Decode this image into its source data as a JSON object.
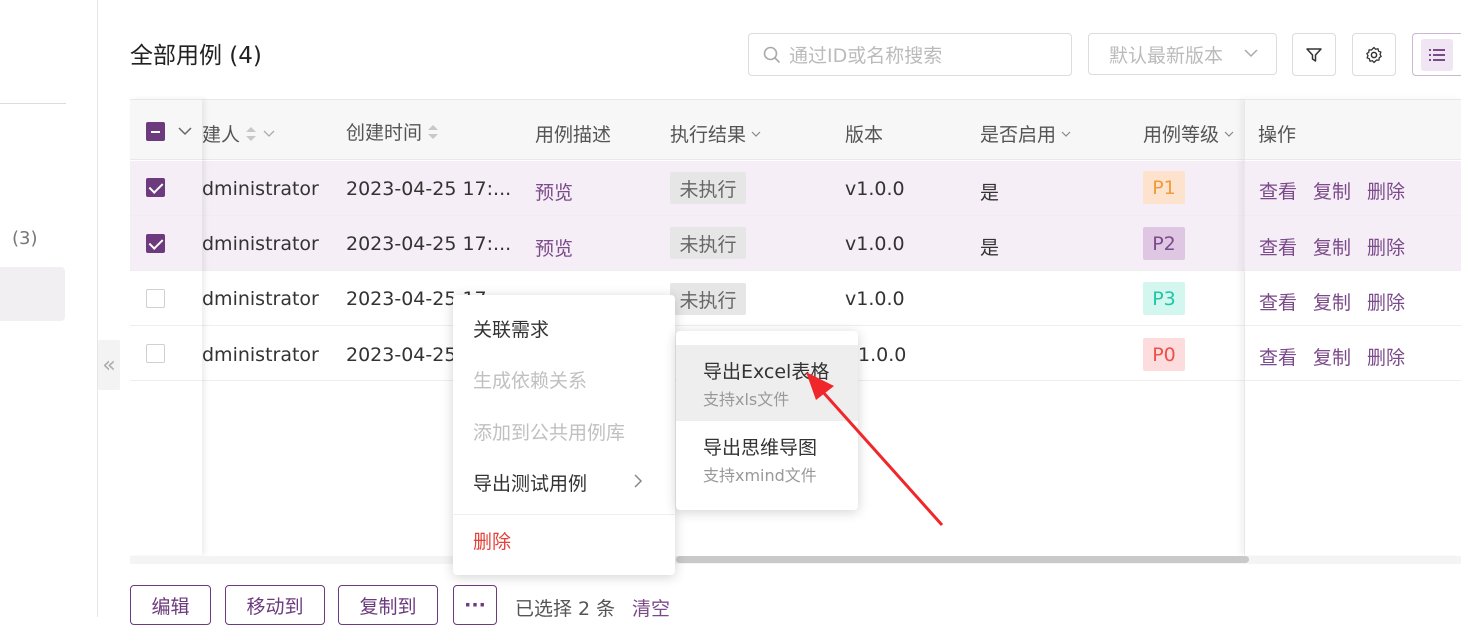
{
  "header": {
    "title": "全部用例 (4)",
    "search_placeholder": "通过ID或名称搜索",
    "version_placeholder": "默认最新版本"
  },
  "sidebar": {
    "count": "(3)"
  },
  "table": {
    "columns": {
      "creator": "建人",
      "created_time": "创建时间",
      "description": "用例描述",
      "result": "执行结果",
      "version": "版本",
      "enabled": "是否启用",
      "level": "用例等级",
      "actions": "操作"
    },
    "rows": [
      {
        "creator": "dministrator",
        "time": "2023-04-25 17:...",
        "desc": "预览",
        "result": "未执行",
        "version": "v1.0.0",
        "enabled": "是",
        "level": "P1"
      },
      {
        "creator": "dministrator",
        "time": "2023-04-25 17:...",
        "desc": "预览",
        "result": "未执行",
        "version": "v1.0.0",
        "enabled": "是",
        "level": "P2"
      },
      {
        "creator": "dministrator",
        "time": "2023-04-25 17",
        "desc": "",
        "result": "未执行",
        "version": "v1.0.0",
        "enabled": "",
        "level": "P3"
      },
      {
        "creator": "dministrator",
        "time": "2023-04-25",
        "desc": "",
        "result": "",
        "version": "1.0.0",
        "enabled": "",
        "level": "P0"
      }
    ],
    "row_actions": {
      "view": "查看",
      "copy": "复制",
      "delete": "删除"
    }
  },
  "bottom_bar": {
    "edit": "编辑",
    "move": "移动到",
    "copy": "复制到",
    "more": "···",
    "selected": "已选择 2 条",
    "clear": "清空"
  },
  "context_menu": {
    "items": [
      "关联需求",
      "生成依赖关系",
      "添加到公共用例库",
      "导出测试用例"
    ],
    "delete": "删除",
    "submenu": [
      {
        "title": "导出Excel表格",
        "desc": "支持xls文件"
      },
      {
        "title": "导出思维导图",
        "desc": "支持xmind文件"
      }
    ]
  },
  "colors": {
    "primary": "#6c3a7d",
    "selected_row": "#f5eef6",
    "danger": "#e5413a",
    "p1_bg": "#fde3cd",
    "p1_fg": "#f29a3a",
    "p2_bg": "#dfc7e4",
    "p2_fg": "#7b4a8a",
    "p3_bg": "#d3f6ee",
    "p3_fg": "#20c6a8",
    "p0_bg": "#fcdcdc",
    "p0_fg": "#f0504a",
    "arrow": "#f0272a"
  }
}
